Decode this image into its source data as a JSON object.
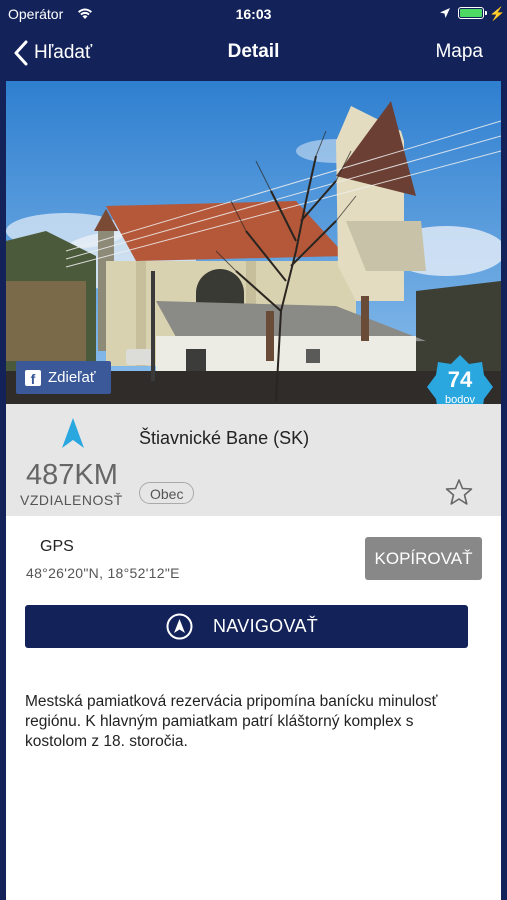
{
  "status": {
    "carrier": "Operátor",
    "time": "16:03"
  },
  "nav": {
    "back_label": "Hľadať",
    "title": "Detail",
    "right_label": "Mapa"
  },
  "photo": {
    "share_label": "Zdieľať",
    "points_value": "74",
    "points_label": "bodov"
  },
  "place": {
    "name": "Štiavnické Bane (SK)",
    "distance": "487KM",
    "distance_label": "VZDIALENOSŤ",
    "category": "Obec"
  },
  "gps": {
    "label": "GPS",
    "coords": "48°26'20\"N, 18°52'12\"E",
    "copy_label": "KOPÍROVAŤ"
  },
  "navigate_label": "NAVIGOVAŤ",
  "description": "Mestská pamiatková rezervácia pripomína banícku minulosť regiónu. K hlavným pamiatkam patrí kláštorný komplex s kostolom z 18. storočia.",
  "colors": {
    "navy": "#13235a",
    "badge": "#2ba7e0",
    "facebook": "#3b5998",
    "arrow": "#2ba7e0"
  }
}
